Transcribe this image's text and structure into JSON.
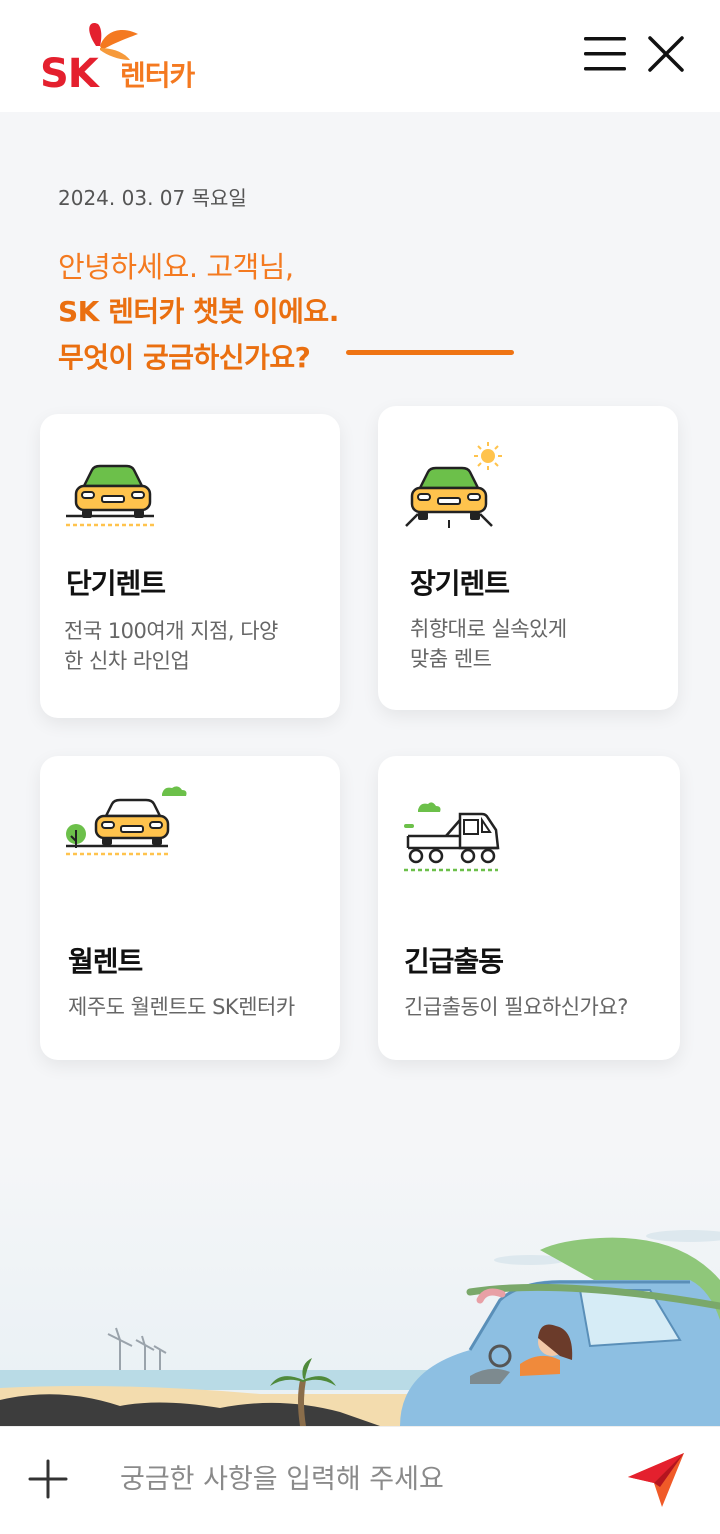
{
  "header": {
    "logo_sk": "SK",
    "logo_text": "렌터카"
  },
  "greeting": {
    "date": "2024. 03. 07 목요일",
    "line1": "안녕하세요. 고객님,",
    "line2": "SK 렌터카 챗봇 이에요.",
    "line3": "무엇이 궁금하신가요?"
  },
  "cards": [
    {
      "title": "단기렌트",
      "desc": "전국 100여개 지점, 다양\n한 신차 라인업",
      "icon": "car-road-icon"
    },
    {
      "title": "장기렌트",
      "desc": "취향대로 실속있게\n맞춤 렌트",
      "icon": "car-sun-icon"
    },
    {
      "title": "월렌트",
      "desc": "제주도 월렌트도 SK렌터카",
      "icon": "car-tree-icon"
    },
    {
      "title": "긴급출동",
      "desc": "긴급출동이 필요하신가요?",
      "icon": "tow-truck-icon"
    }
  ],
  "input": {
    "placeholder": "궁금한 사항을 입력해 주세요"
  },
  "colors": {
    "brand_orange": "#f47920",
    "brand_red": "#e4202e",
    "car_yellow": "#ffc34d",
    "accent_green": "#6cc04a"
  }
}
